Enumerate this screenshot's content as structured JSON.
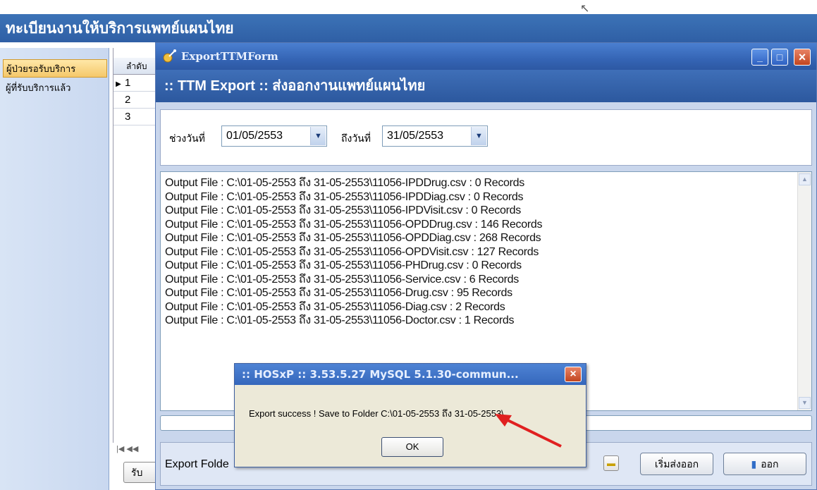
{
  "app": {
    "title": "ทะเบียนงานให้บริการแพทย์แผนไทย"
  },
  "left_nav": {
    "items": [
      {
        "label": "ผู้ป่วยรอรับบริการ"
      },
      {
        "label": "ผู้ที่รับบริการแล้ว"
      }
    ]
  },
  "background_grid": {
    "header": "ลำดับ",
    "rows": [
      "1",
      "2",
      "3"
    ],
    "pager": "|◀ ◀◀",
    "partial_button": "รับ"
  },
  "window": {
    "title": "ExportTTMForm",
    "header": ":: TTM Export  :: ส่งออกงานแพทย์แผนไทย",
    "controls": {
      "minimize": "_",
      "maximize": "□",
      "close": "×"
    }
  },
  "date_range": {
    "from_label": "ช่วงวันที่",
    "from_value": "01/05/2553",
    "to_label": "ถึงวันที่",
    "to_value": "31/05/2553"
  },
  "log": {
    "lines": [
      "Output File : C:\\01-05-2553 ถึง 31-05-2553\\11056-IPDDrug.csv : 0 Records",
      "Output File : C:\\01-05-2553 ถึง 31-05-2553\\11056-IPDDiag.csv : 0 Records",
      "Output File : C:\\01-05-2553 ถึง 31-05-2553\\11056-IPDVisit.csv : 0 Records",
      "Output File : C:\\01-05-2553 ถึง 31-05-2553\\11056-OPDDrug.csv : 146 Records",
      "Output File : C:\\01-05-2553 ถึง 31-05-2553\\11056-OPDDiag.csv : 268 Records",
      "Output File : C:\\01-05-2553 ถึง 31-05-2553\\11056-OPDVisit.csv : 127 Records",
      "Output File : C:\\01-05-2553 ถึง 31-05-2553\\11056-PHDrug.csv : 0 Records",
      "Output File : C:\\01-05-2553 ถึง 31-05-2553\\11056-Service.csv : 6 Records",
      "Output File : C:\\01-05-2553 ถึง 31-05-2553\\11056-Drug.csv : 95 Records",
      "Output File : C:\\01-05-2553 ถึง 31-05-2553\\11056-Diag.csv : 2 Records",
      "Output File : C:\\01-05-2553 ถึง 31-05-2553\\11056-Doctor.csv : 1 Records"
    ]
  },
  "bottom": {
    "folder_label": "Export Folde",
    "start_button": "เริ่มส่งออก",
    "exit_button": "ออก"
  },
  "message_box": {
    "title": ":: HOSxP :: 3.53.5.27 MySQL 5.1.30-commun...",
    "text": "Export success ! Save to Folder C:\\01-05-2553 ถึง 31-05-2553\\",
    "ok_label": "OK",
    "close": "×"
  },
  "colors": {
    "title_blue": "#2f5fa5",
    "annotation_arrow": "#e02020",
    "nav_active": "#f5c86a"
  },
  "icons": {
    "window_icon": "satellite-icon",
    "folder_browse": "folder-icon",
    "exit": "door-icon"
  }
}
